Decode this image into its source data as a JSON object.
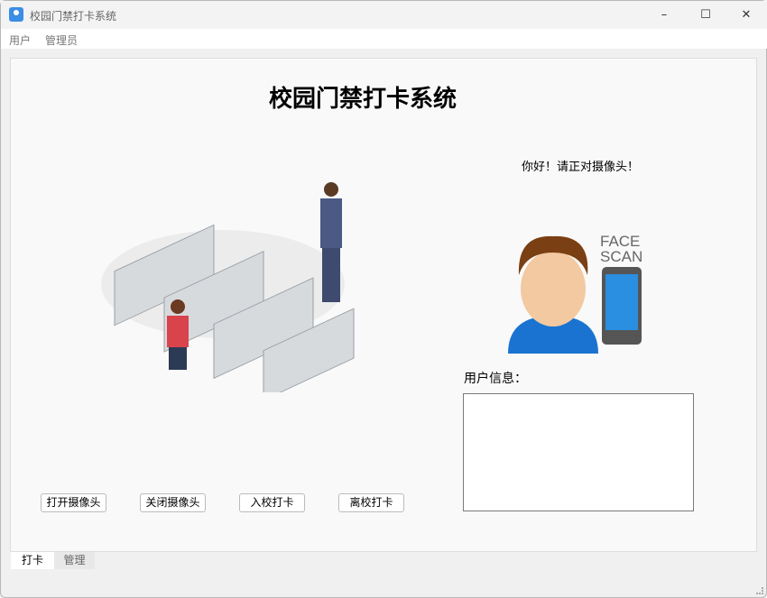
{
  "window": {
    "title": "校园门禁打卡系统",
    "minimize": "–",
    "maximize": "☐",
    "close": "✕"
  },
  "menu": [
    "用户",
    "管理员"
  ],
  "main": {
    "heading": "校园门禁打卡系统",
    "greeting": "你好！请正对摄像头！",
    "user_info_label": "用户信息：",
    "user_info_value": "",
    "face_scan_text": [
      "FACE",
      "SCAN"
    ]
  },
  "buttons": [
    "打开摄像头",
    "关闭摄像头",
    "入校打卡",
    "离校打卡"
  ],
  "tabs": [
    {
      "label": "打卡",
      "active": true
    },
    {
      "label": "管理",
      "active": false
    }
  ]
}
